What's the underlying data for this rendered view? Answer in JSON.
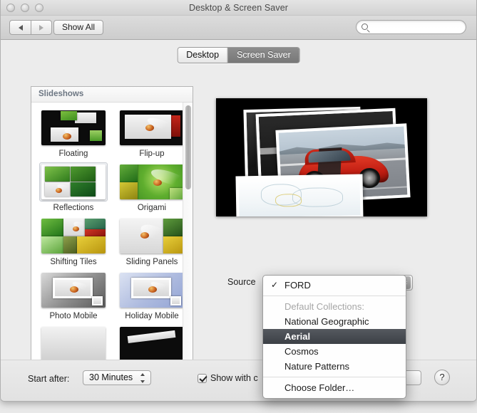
{
  "window": {
    "title": "Desktop & Screen Saver",
    "traffic_lights": [
      "close-button",
      "minimize-button",
      "zoom-button"
    ]
  },
  "toolbar": {
    "back_label": "◀",
    "forward_label": "▶",
    "show_all_label": "Show All",
    "search_placeholder": "",
    "search_value": "",
    "search_icon": "search-icon"
  },
  "tabs": [
    {
      "label": "Desktop",
      "active": false
    },
    {
      "label": "Screen Saver",
      "active": true
    }
  ],
  "screensaver_list": {
    "group_header": "Slideshows",
    "items": [
      {
        "label": "Floating",
        "selected": false
      },
      {
        "label": "Flip-up",
        "selected": false
      },
      {
        "label": "Reflections",
        "selected": true
      },
      {
        "label": "Origami",
        "selected": false
      },
      {
        "label": "Shifting Tiles",
        "selected": false
      },
      {
        "label": "Sliding Panels",
        "selected": false
      },
      {
        "label": "Photo Mobile",
        "selected": false
      },
      {
        "label": "Holiday Mobile",
        "selected": false
      }
    ]
  },
  "preview": {
    "style": "floating-photos-slideshow",
    "background_color": "#000000"
  },
  "source": {
    "label": "Source",
    "selected_value": "FORD"
  },
  "menu": {
    "open": true,
    "checked_item": "FORD",
    "items": [
      {
        "label": "FORD",
        "type": "item",
        "checked": true,
        "highlight": false
      },
      {
        "label": "",
        "type": "separator"
      },
      {
        "label": "Default Collections:",
        "type": "header",
        "checked": false,
        "highlight": false
      },
      {
        "label": "National Geographic",
        "type": "item",
        "checked": false,
        "highlight": false
      },
      {
        "label": "Aerial",
        "type": "item",
        "checked": false,
        "highlight": true
      },
      {
        "label": "Cosmos",
        "type": "item",
        "checked": false,
        "highlight": false
      },
      {
        "label": "Nature Patterns",
        "type": "item",
        "checked": false,
        "highlight": false
      },
      {
        "label": "",
        "type": "separator"
      },
      {
        "label": "Choose Folder…",
        "type": "item",
        "checked": false,
        "highlight": false
      }
    ],
    "highlight_color": "#3c4046"
  },
  "bottom_bar": {
    "start_after_label": "Start after:",
    "start_after_value": "30 Minutes",
    "show_with_clock_label": "Show with c",
    "show_with_clock_checked": true,
    "options_button_label": "…",
    "help_button_label": "?"
  }
}
